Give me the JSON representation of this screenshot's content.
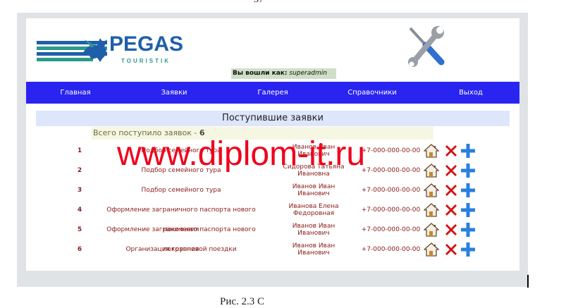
{
  "page": {
    "top_caption": "37",
    "bottom_caption": "Рис. 2.3 С"
  },
  "header": {
    "logo_text": "PEGAS",
    "logo_sub": "TOURISTIK",
    "login_label": "Вы вошли как:",
    "login_user": "superadmin",
    "tools_icon": "wrench-screwdriver-icon"
  },
  "nav": {
    "items": [
      {
        "label": "Главная"
      },
      {
        "label": "Заявки"
      },
      {
        "label": "Галерея"
      },
      {
        "label": "Справочники"
      },
      {
        "label": "Выход"
      }
    ],
    "color": "#2a24f0"
  },
  "main": {
    "title": "Поступившие заявки",
    "total_label": "Всего поступило заявок -",
    "total_value": "6",
    "rows": [
      {
        "num": "1",
        "title": "Подбор семейного тура",
        "name": "Иванов Иван Иванович",
        "phone": "+7-000-000-00-00"
      },
      {
        "num": "2",
        "title": "Подбор семейного тура",
        "name": "Сидорова Татьяна Ивановна",
        "phone": "+7-000-000-00-00"
      },
      {
        "num": "3",
        "title": "Подбор семейного тура",
        "name": "Иванов Иван Иванович",
        "phone": "+7-000-000-00-00"
      },
      {
        "num": "4",
        "title": "Оформление заграничного паспорта нового поколения",
        "name": "Иванова Елена Федоровная",
        "phone": "+7-000-000-00-00"
      },
      {
        "num": "5",
        "title": "Оформление заграничного паспорта нового поколения",
        "name": "Иванов Иван Иванович",
        "phone": "+7-000-000-00-00"
      },
      {
        "num": "6",
        "title": "Организация групповой поездки",
        "name": "Иванов Иван Иванович",
        "phone": "+7-000-000-00-00"
      }
    ],
    "action_icons": [
      "home-icon",
      "delete-x-icon",
      "add-plus-icon"
    ]
  },
  "watermark": "www.diplom-it.ru"
}
